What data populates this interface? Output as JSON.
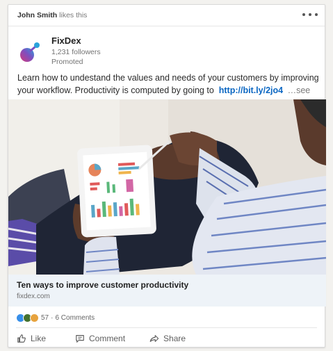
{
  "social_header": {
    "name": "John Smith",
    "action": "likes this"
  },
  "actor": {
    "name": "FixDex",
    "followers": "1,231 followers",
    "promoted": "Promoted"
  },
  "commentary": {
    "text": "Learn how to undestand the values and needs of your customers by improving your workflow. Productivity is computed by going to",
    "link": "http://bit.ly/2jo4",
    "see_more": "…see more"
  },
  "hero_image": {
    "alt": "Person holding a tablet showing business charts"
  },
  "article": {
    "title": "Ten ways to improve customer productivity",
    "domain": "fixdex.com"
  },
  "social_counts": {
    "reactions": "57",
    "separator": "·",
    "comments": "6 Comments"
  },
  "actions": {
    "like": "Like",
    "comment": "Comment",
    "share": "Share"
  },
  "colors": {
    "link": "#0a66c2",
    "article_bg": "#eef3f8",
    "logo_blue": "#2aa3dc",
    "logo_pink": "#d23a7c"
  }
}
